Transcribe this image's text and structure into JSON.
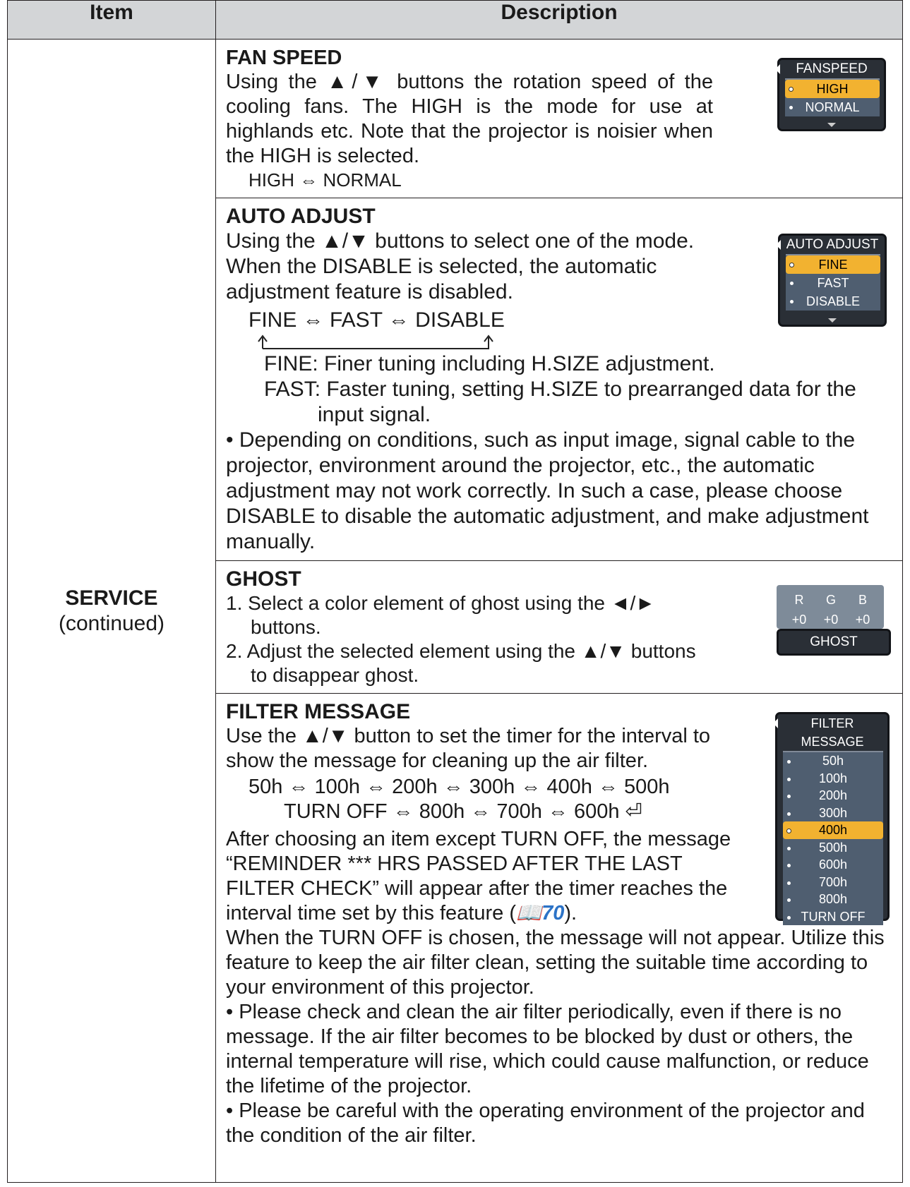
{
  "table": {
    "headers": [
      "Item",
      "Description"
    ]
  },
  "item": {
    "name": "SERVICE",
    "note": "(continued)"
  },
  "fan_speed": {
    "title": "FAN SPEED",
    "desc": "Using the ▲/▼ buttons the rotation speed of the cooling fans. The HIGH is the mode for use at highlands etc. Note that the projector is noisier when the HIGH is selected.",
    "cycle": "HIGH ⇔ NORMAL",
    "osd": {
      "title": "FANSPEED",
      "options": [
        "HIGH",
        "NORMAL"
      ],
      "selected": "HIGH"
    }
  },
  "auto_adjust": {
    "title": "AUTO ADJUST",
    "desc": "Using the ▲/▼ buttons to select one of the mode. When the DISABLE is selected, the automatic adjustment feature is disabled.",
    "cycle": "FINE ⇔ FAST ⇔ DISABLE",
    "fine_note": "FINE: Finer tuning including H.SIZE adjustment.",
    "fast_note": "FAST: Faster tuning, setting H.SIZE to prearranged data for the input signal.",
    "caution": "• Depending on conditions, such as input image, signal cable to the projector, environment around the projector, etc., the automatic adjustment may not work correctly. In such a case, please choose DISABLE to disable the automatic adjustment, and make adjustment manually.",
    "osd": {
      "title": "AUTO ADJUST",
      "options": [
        "FINE",
        "FAST",
        "DISABLE"
      ],
      "selected": "FINE"
    }
  },
  "ghost": {
    "title": "GHOST",
    "steps": [
      "1. Select a color element of ghost using the ◄/► buttons.",
      "2. Adjust the selected element using the ▲/▼ buttons to disappear ghost."
    ],
    "osd": {
      "title": "GHOST",
      "labels": [
        "R",
        "G",
        "B"
      ],
      "values": [
        "+0",
        "+0",
        "+0"
      ]
    }
  },
  "filter_message": {
    "title": "FILTER MESSAGE",
    "desc": "Use the ▲/▼ button to set the timer for the interval to show the message for cleaning up the air filter.",
    "cycle_1": "50h ⇔ 100h ⇔ 200h ⇔ 300h ⇔ 400h ⇔ 500h",
    "cycle_2": "TURN OFF ⇔ 800h ⇔ 700h ⇔ 600h ⏎",
    "after_text": "After choosing an item except TURN OFF, the message “REMINDER *** HRS PASSED AFTER THE LAST FILTER CHECK” will appear after the timer reaches the interval time set by this feature",
    "page_ref": "📖70",
    "turn_off_note": "When the TURN OFF is chosen, the message will not appear. Utilize this feature to keep the air filter clean, setting the suitable time according to your environment of this projector.",
    "caution_1": "• Please check and clean the air filter periodically, even if there is no message. If the air filter becomes to be blocked by dust or others, the internal temperature will rise, which could cause malfunction, or reduce the lifetime of the projector.",
    "caution_2": "• Please be careful with the operating environment of the projector and the condition of the air filter.",
    "osd": {
      "title": "FILTER MESSAGE",
      "options": [
        "50h",
        "100h",
        "200h",
        "300h",
        "400h",
        "500h",
        "600h",
        "700h",
        "800h",
        "TURN OFF"
      ],
      "selected": "400h"
    }
  },
  "colors": {
    "header_bg": "#d3d5d7",
    "osd_bg": "#2a2f36",
    "osd_list_bg": "#4f5e70",
    "osd_selected": "#f2b230",
    "link": "#2c73c7"
  }
}
